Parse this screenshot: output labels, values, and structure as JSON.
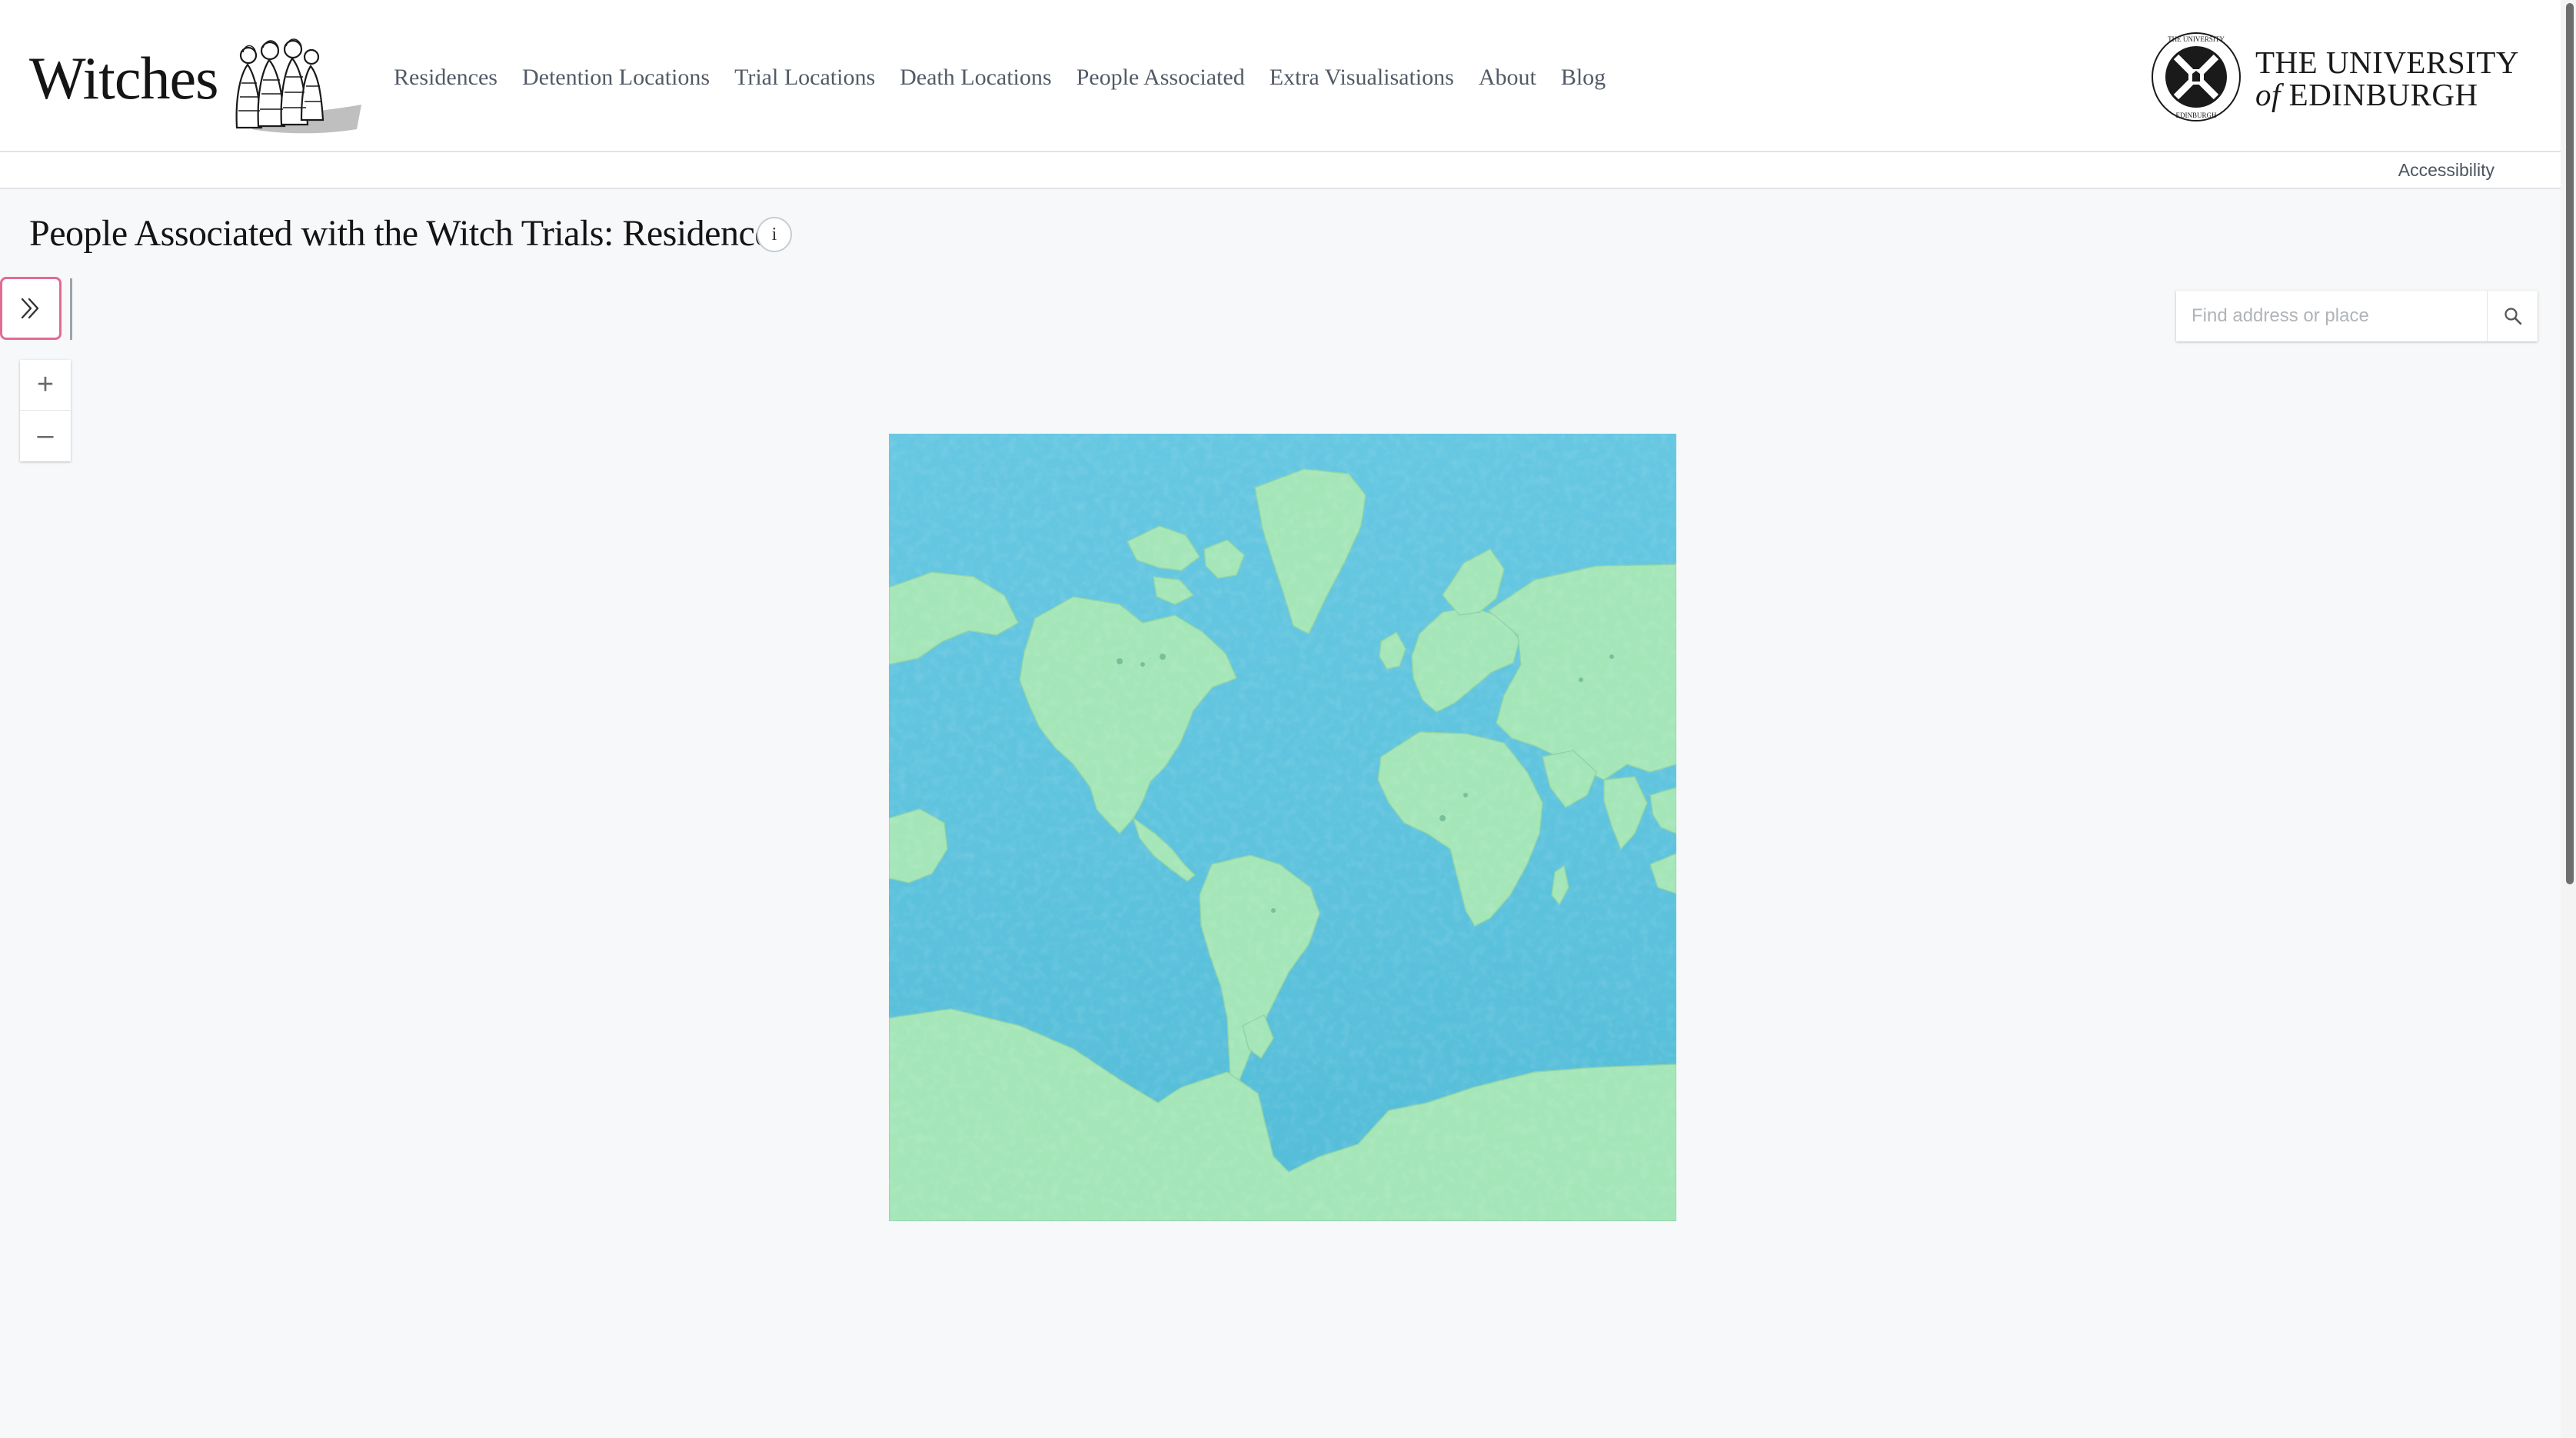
{
  "site": {
    "title": "Witches"
  },
  "nav": [
    {
      "label": "Residences"
    },
    {
      "label": "Detention Locations"
    },
    {
      "label": "Trial Locations"
    },
    {
      "label": "Death Locations"
    },
    {
      "label": "People Associated"
    },
    {
      "label": "Extra Visualisations"
    },
    {
      "label": "About"
    },
    {
      "label": "Blog"
    }
  ],
  "university": {
    "line1": "THE UNIVERSITY",
    "of": "of",
    "line2": "EDINBURGH",
    "logo_icon": "university-crest-icon"
  },
  "subbar": {
    "accessibility_label": "Accessibility"
  },
  "page": {
    "title": "People Associated with the Witch Trials: Residence",
    "info_symbol": "i"
  },
  "map": {
    "panel_toggle_icon": "chevron-double-right-icon",
    "zoom_in": "+",
    "zoom_out": "–",
    "search_placeholder": "Find address or place",
    "search_icon": "search-icon",
    "basemap_style": "watercolor",
    "colors": {
      "ocean": "#5cc6df",
      "land": "#a4e6b8",
      "accent_toggle": "#e36a92"
    }
  }
}
